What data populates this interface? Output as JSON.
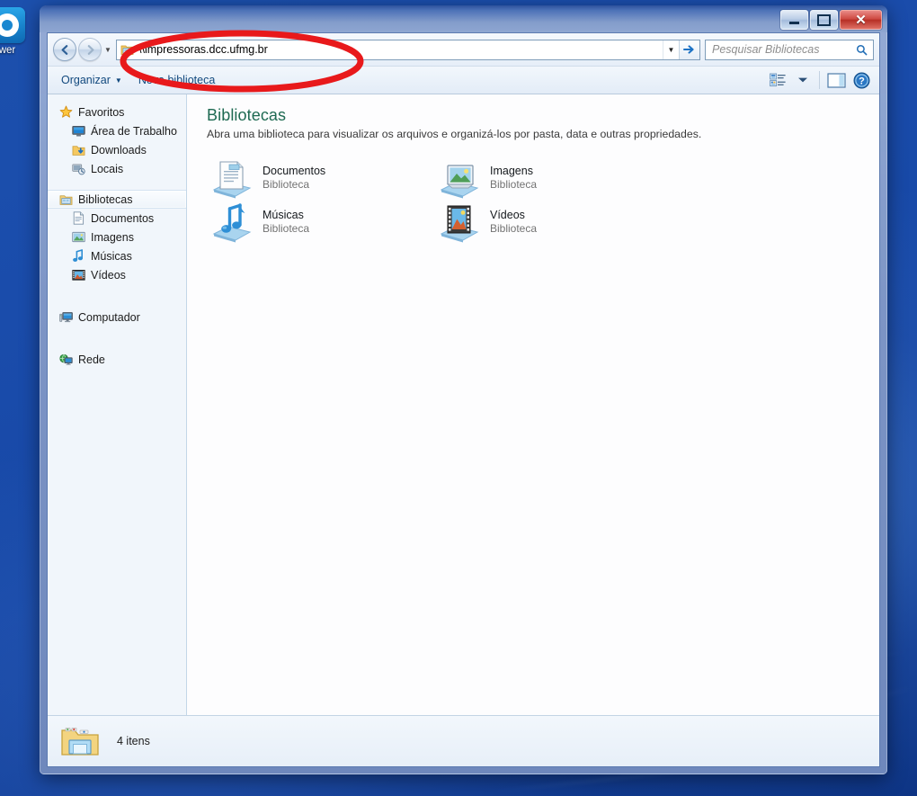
{
  "desktop": {
    "icon": {
      "name": "teamviewer-icon",
      "label": "wer"
    }
  },
  "window": {
    "title": "",
    "controls": {
      "minimize": "Minimizar",
      "maximize": "Maximizar",
      "close": "Fechar"
    }
  },
  "addressbar": {
    "back_tooltip": "Voltar",
    "forward_tooltip": "Avançar",
    "path": "\\\\impressoras.dcc.ufmg.br",
    "history_dropdown": "▼",
    "go_tooltip": "Ir"
  },
  "search": {
    "placeholder": "Pesquisar Bibliotecas",
    "value": ""
  },
  "toolbar": {
    "organize_label": "Organizar",
    "new_library_label": "Nova biblioteca",
    "view_tooltip": "Alterar modo de exibição",
    "preview_tooltip": "Mostrar o painel de visualização",
    "help_tooltip": "Ajuda"
  },
  "sidebar": {
    "groups": [
      {
        "header": {
          "label": "Favoritos",
          "icon": "star-icon"
        },
        "items": [
          {
            "label": "Área de Trabalho",
            "icon": "desktop-icon"
          },
          {
            "label": "Downloads",
            "icon": "download-folder-icon"
          },
          {
            "label": "Locais",
            "icon": "recent-places-icon"
          }
        ]
      },
      {
        "header": {
          "label": "Bibliotecas",
          "icon": "library-icon",
          "selected": true
        },
        "items": [
          {
            "label": "Documentos",
            "icon": "documents-icon"
          },
          {
            "label": "Imagens",
            "icon": "pictures-icon"
          },
          {
            "label": "Músicas",
            "icon": "music-icon"
          },
          {
            "label": "Vídeos",
            "icon": "videos-icon"
          }
        ]
      },
      {
        "header": {
          "label": "Computador",
          "icon": "computer-icon"
        },
        "items": []
      },
      {
        "header": {
          "label": "Rede",
          "icon": "network-icon"
        },
        "items": []
      }
    ]
  },
  "main": {
    "title": "Bibliotecas",
    "subtitle": "Abra uma biblioteca para visualizar os arquivos e organizá-los por pasta, data e outras propriedades.",
    "libraries": [
      {
        "name": "Documentos",
        "kind": "Biblioteca",
        "icon": "documents-library-icon"
      },
      {
        "name": "Imagens",
        "kind": "Biblioteca",
        "icon": "pictures-library-icon"
      },
      {
        "name": "Músicas",
        "kind": "Biblioteca",
        "icon": "music-library-icon"
      },
      {
        "name": "Vídeos",
        "kind": "Biblioteca",
        "icon": "videos-library-icon"
      }
    ]
  },
  "statusbar": {
    "icon": "library-folder-icon",
    "item_count": "4 itens"
  },
  "annotation": {
    "shape": "ellipse",
    "color": "#e8191b",
    "stroke_width": 7,
    "target": "address bar"
  },
  "colors": {
    "title_accent": "#1e6a52",
    "link_blue": "#12497e",
    "annotation_red": "#e8191b",
    "desktop_blue": "#1748a6"
  }
}
